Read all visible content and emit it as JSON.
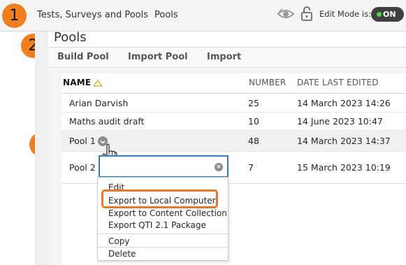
{
  "breadcrumb": {
    "item1": "Tests, Surveys and Pools",
    "item2": "Pools"
  },
  "header": {
    "edit_mode_label": "Edit Mode is:",
    "edit_mode_value": "ON"
  },
  "callouts": [
    "1",
    "2",
    "3"
  ],
  "page": {
    "title": "Pools"
  },
  "actions": {
    "build": "Build Pool",
    "import_pool": "Import Pool",
    "import": "Import"
  },
  "table": {
    "headers": {
      "name": "NAME",
      "number": "NUMBER",
      "date": "DATE LAST EDITED"
    },
    "rows": [
      {
        "name": "Arian Darvish",
        "number": "25",
        "date": "14 March 2023 14:26"
      },
      {
        "name": "Maths audit draft",
        "number": "10",
        "date": "14 June 2023 10:47"
      },
      {
        "name": "Pool 1",
        "number": "48",
        "date": "14 March 2023 14:37"
      },
      {
        "name": "Pool 2",
        "number": "7",
        "date": "15 March 2023 10:19"
      }
    ]
  },
  "menu": {
    "search_value": "",
    "items": [
      "Edit",
      "Export to Local Computer",
      "Export to Content Collection",
      "Export QTI 2.1 Package",
      "Copy",
      "Delete"
    ]
  },
  "colors": {
    "callout": "#f07f1f",
    "highlight": "#e8772a",
    "focus": "#2f7fc2",
    "toggle_dot": "#4cd43e"
  }
}
